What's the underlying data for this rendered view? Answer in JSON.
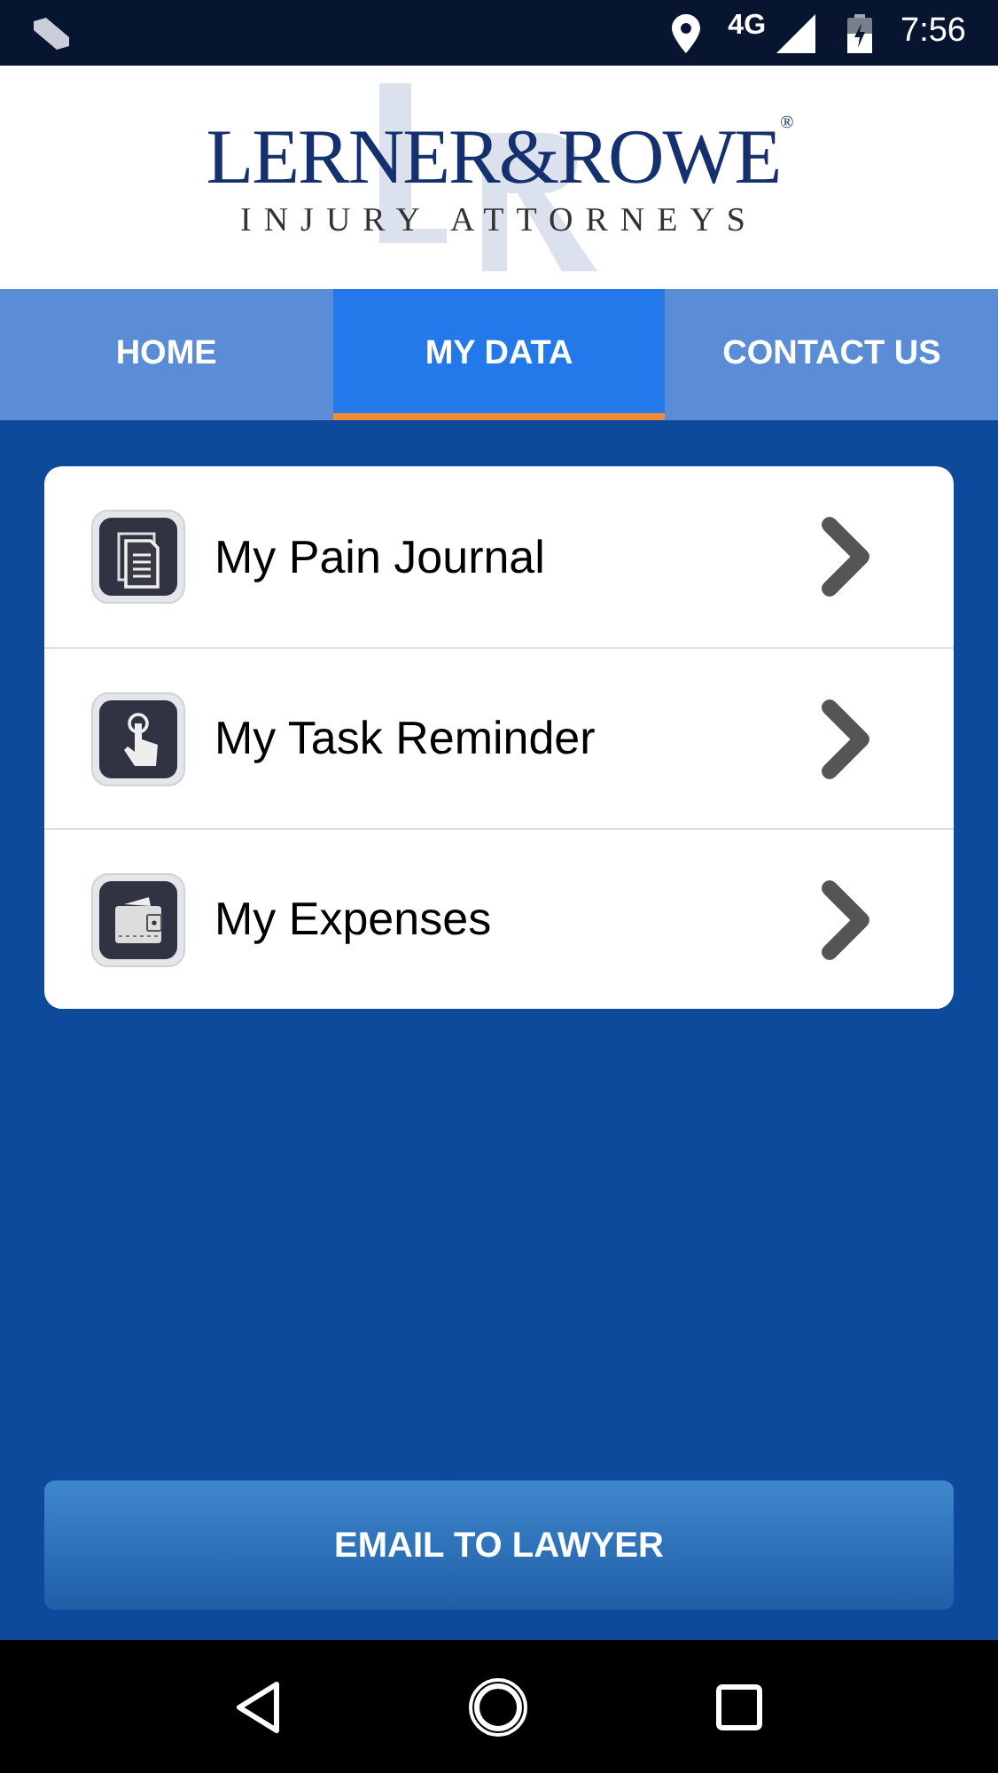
{
  "status_bar": {
    "network": "4G",
    "time": "7:56"
  },
  "header": {
    "brand": "LERNER&ROWE$^{®}$",
    "tagline": "INJURY ATTORNEYS"
  },
  "tabs": [
    {
      "label": "HOME",
      "selected": false
    },
    {
      "label": "MY DATA",
      "selected": true
    },
    {
      "label": "CONTACT US",
      "selected": false
    }
  ],
  "menu": [
    {
      "label": "My Pain Journal",
      "kind": "journal"
    },
    {
      "label": "My Task Reminder",
      "kind": "reminder"
    },
    {
      "label": "My Expenses",
      "kind": "expenses"
    }
  ],
  "action_button": "EMAIL TO LAWYER"
}
